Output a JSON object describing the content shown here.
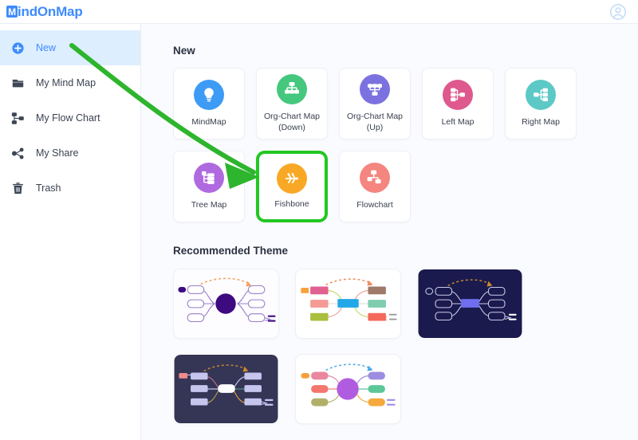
{
  "header": {
    "logo_text": "indOnMap",
    "logo_badge": "M",
    "avatar_icon": "user-avatar-icon",
    "logo_color": "#3d8bfd"
  },
  "sidebar": {
    "items": [
      {
        "label": "New",
        "icon": "plus-circle-icon",
        "active": true
      },
      {
        "label": "My Mind Map",
        "icon": "folder-icon",
        "active": false
      },
      {
        "label": "My Flow Chart",
        "icon": "flow-chart-icon",
        "active": false
      },
      {
        "label": "My Share",
        "icon": "share-nodes-icon",
        "active": false
      },
      {
        "label": "Trash",
        "icon": "trash-icon",
        "active": false
      }
    ],
    "active_color": "#3d8bfd",
    "active_bg": "#ddeeff"
  },
  "main": {
    "new_section_title": "New",
    "theme_section_title": "Recommended Theme",
    "selection_highlight_color": "#22c722",
    "cards": [
      {
        "label": "MindMap",
        "icon": "lightbulb-icon",
        "color": "#3d9bf5",
        "selected": false
      },
      {
        "label": "Org-Chart Map (Down)",
        "icon": "org-chart-down-icon",
        "color": "#45c87e",
        "selected": false
      },
      {
        "label": "Org-Chart Map (Up)",
        "icon": "org-chart-up-icon",
        "color": "#7b72e0",
        "selected": false
      },
      {
        "label": "Left Map",
        "icon": "left-map-icon",
        "color": "#de5a8e",
        "selected": false
      },
      {
        "label": "Right Map",
        "icon": "right-map-icon",
        "color": "#5cc9c6",
        "selected": false
      },
      {
        "label": "Tree Map",
        "icon": "tree-map-icon",
        "color": "#b06ae0",
        "selected": false
      },
      {
        "label": "Fishbone",
        "icon": "fishbone-icon",
        "color": "#f9a825",
        "selected": true
      },
      {
        "label": "Flowchart",
        "icon": "flowchart-icon",
        "color": "#f4867f",
        "selected": false
      }
    ],
    "themes": [
      {
        "name": "theme-violet-light",
        "background": "#fdfcff",
        "center": "#3d0a80",
        "node": "#ffffff",
        "stroke": "#9a7fc9",
        "arrow": "#f5a25d",
        "badge": "#3d0a80",
        "center_shape": "circle"
      },
      {
        "name": "theme-colorful-light",
        "background": "#ffffff",
        "center": "#22a7e8",
        "node": "#ffffff",
        "stroke": "#d8d8d8",
        "arrow": "#f08a5d",
        "badge": "#f6a13c",
        "center_shape": "rect"
      },
      {
        "name": "theme-midnight-navy",
        "background": "#1a1a4e",
        "center": "#6f6ef0",
        "node": "#1a1a4e",
        "stroke": "#c9cbe8",
        "arrow": "#c98b2a",
        "badge": "#1a1a4e",
        "center_shape": "rect"
      },
      {
        "name": "theme-slate-purple",
        "background": "#353556",
        "center": "#ffffff",
        "node": "#c5c5ee",
        "stroke": "#c5c5ee",
        "arrow": "#c98b2a",
        "badge": "#ef8b8b",
        "center_shape": "rect"
      },
      {
        "name": "theme-pastel-purple",
        "background": "#ffffff",
        "center": "#b05ce0",
        "node": "#ffffff",
        "stroke": "#dcdcdc",
        "arrow": "#4aa8e8",
        "badge": "#f6a13c",
        "center_shape": "circle"
      }
    ]
  },
  "annotation": {
    "arrow_color": "#2db52d",
    "arrow_name": "green-pointer-arrow"
  }
}
